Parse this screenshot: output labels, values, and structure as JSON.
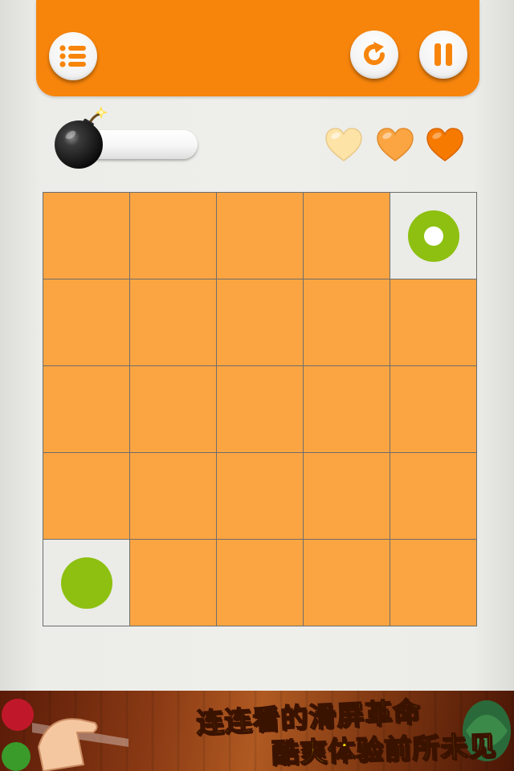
{
  "header": {
    "menu_icon": "list-icon",
    "restart_icon": "restart-icon",
    "pause_icon": "pause-icon",
    "accent_color": "#f7850c"
  },
  "status": {
    "bomb_icon": "bomb-icon",
    "timer_remaining_fraction": 0,
    "lives": [
      {
        "icon": "heart-icon",
        "color": "#fde3a6"
      },
      {
        "icon": "heart-icon",
        "color": "#fba542"
      },
      {
        "icon": "heart-icon",
        "color": "#f77a00"
      }
    ]
  },
  "board": {
    "rows": 5,
    "cols": 5,
    "tile_color": "#fba542",
    "empty_color": "#ebebe7",
    "piece_color": "#8dc010",
    "cells": [
      [
        "tile",
        "tile",
        "tile",
        "tile",
        "ring"
      ],
      [
        "tile",
        "tile",
        "tile",
        "tile",
        "tile"
      ],
      [
        "tile",
        "tile",
        "tile",
        "tile",
        "tile"
      ],
      [
        "tile",
        "tile",
        "tile",
        "tile",
        "tile"
      ],
      [
        "dot",
        "tile",
        "tile",
        "tile",
        "tile"
      ]
    ]
  },
  "ad_banner": {
    "line1": "连连看的滑屏革命",
    "line2": "酷爽体验前所未见"
  }
}
